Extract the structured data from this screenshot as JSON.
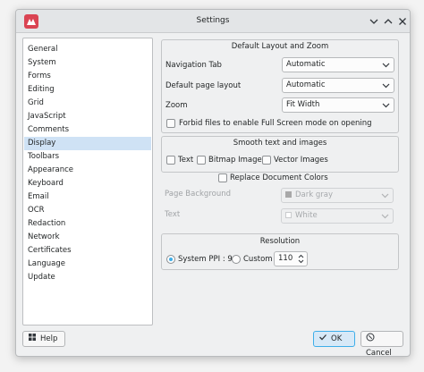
{
  "window": {
    "title": "Settings"
  },
  "titlebar": {
    "app_icon": "app-logo-icon",
    "help_icon": "chevron-down-icon",
    "maximize_icon": "maximize-icon",
    "close_icon": "close-icon"
  },
  "sidebar": {
    "selected": "Display",
    "items": [
      "General",
      "System",
      "Forms",
      "Editing",
      "Grid",
      "JavaScript",
      "Comments",
      "Display",
      "Toolbars",
      "Appearance",
      "Keyboard",
      "Email",
      "OCR",
      "Redaction",
      "Network",
      "Certificates",
      "Language",
      "Update"
    ]
  },
  "layout_group": {
    "title": "Default Layout and Zoom",
    "navigation_tab": {
      "label": "Navigation Tab",
      "value": "Automatic"
    },
    "page_layout": {
      "label": "Default page layout",
      "value": "Automatic"
    },
    "zoom": {
      "label": "Zoom",
      "value": "Fit Width"
    },
    "forbid_fullscreen": {
      "label": "Forbid files to enable Full Screen mode on opening",
      "checked": false
    }
  },
  "smooth_group": {
    "title": "Smooth text and images",
    "options": [
      {
        "label": "Text",
        "checked": false
      },
      {
        "label": "Bitmap Images",
        "checked": false
      },
      {
        "label": "Vector Images",
        "checked": false
      }
    ]
  },
  "replace_colors": {
    "label": "Replace Document Colors",
    "checked": false,
    "page_background": {
      "label": "Page Background",
      "value": "Dark gray",
      "color": "#a8a8a8"
    },
    "text": {
      "label": "Text",
      "value": "White",
      "color": "#ffffff"
    }
  },
  "resolution_group": {
    "title": "Resolution",
    "system_ppi": {
      "label": "System PPI : 96",
      "checked": true
    },
    "custom": {
      "label": "Custom",
      "checked": false,
      "value": "110"
    }
  },
  "buttons": {
    "help": "Help",
    "ok": "OK",
    "cancel": "Cancel"
  },
  "colors": {
    "accent": "#3daee9",
    "selection": "#cfe2f5",
    "brand": "#da4453"
  }
}
